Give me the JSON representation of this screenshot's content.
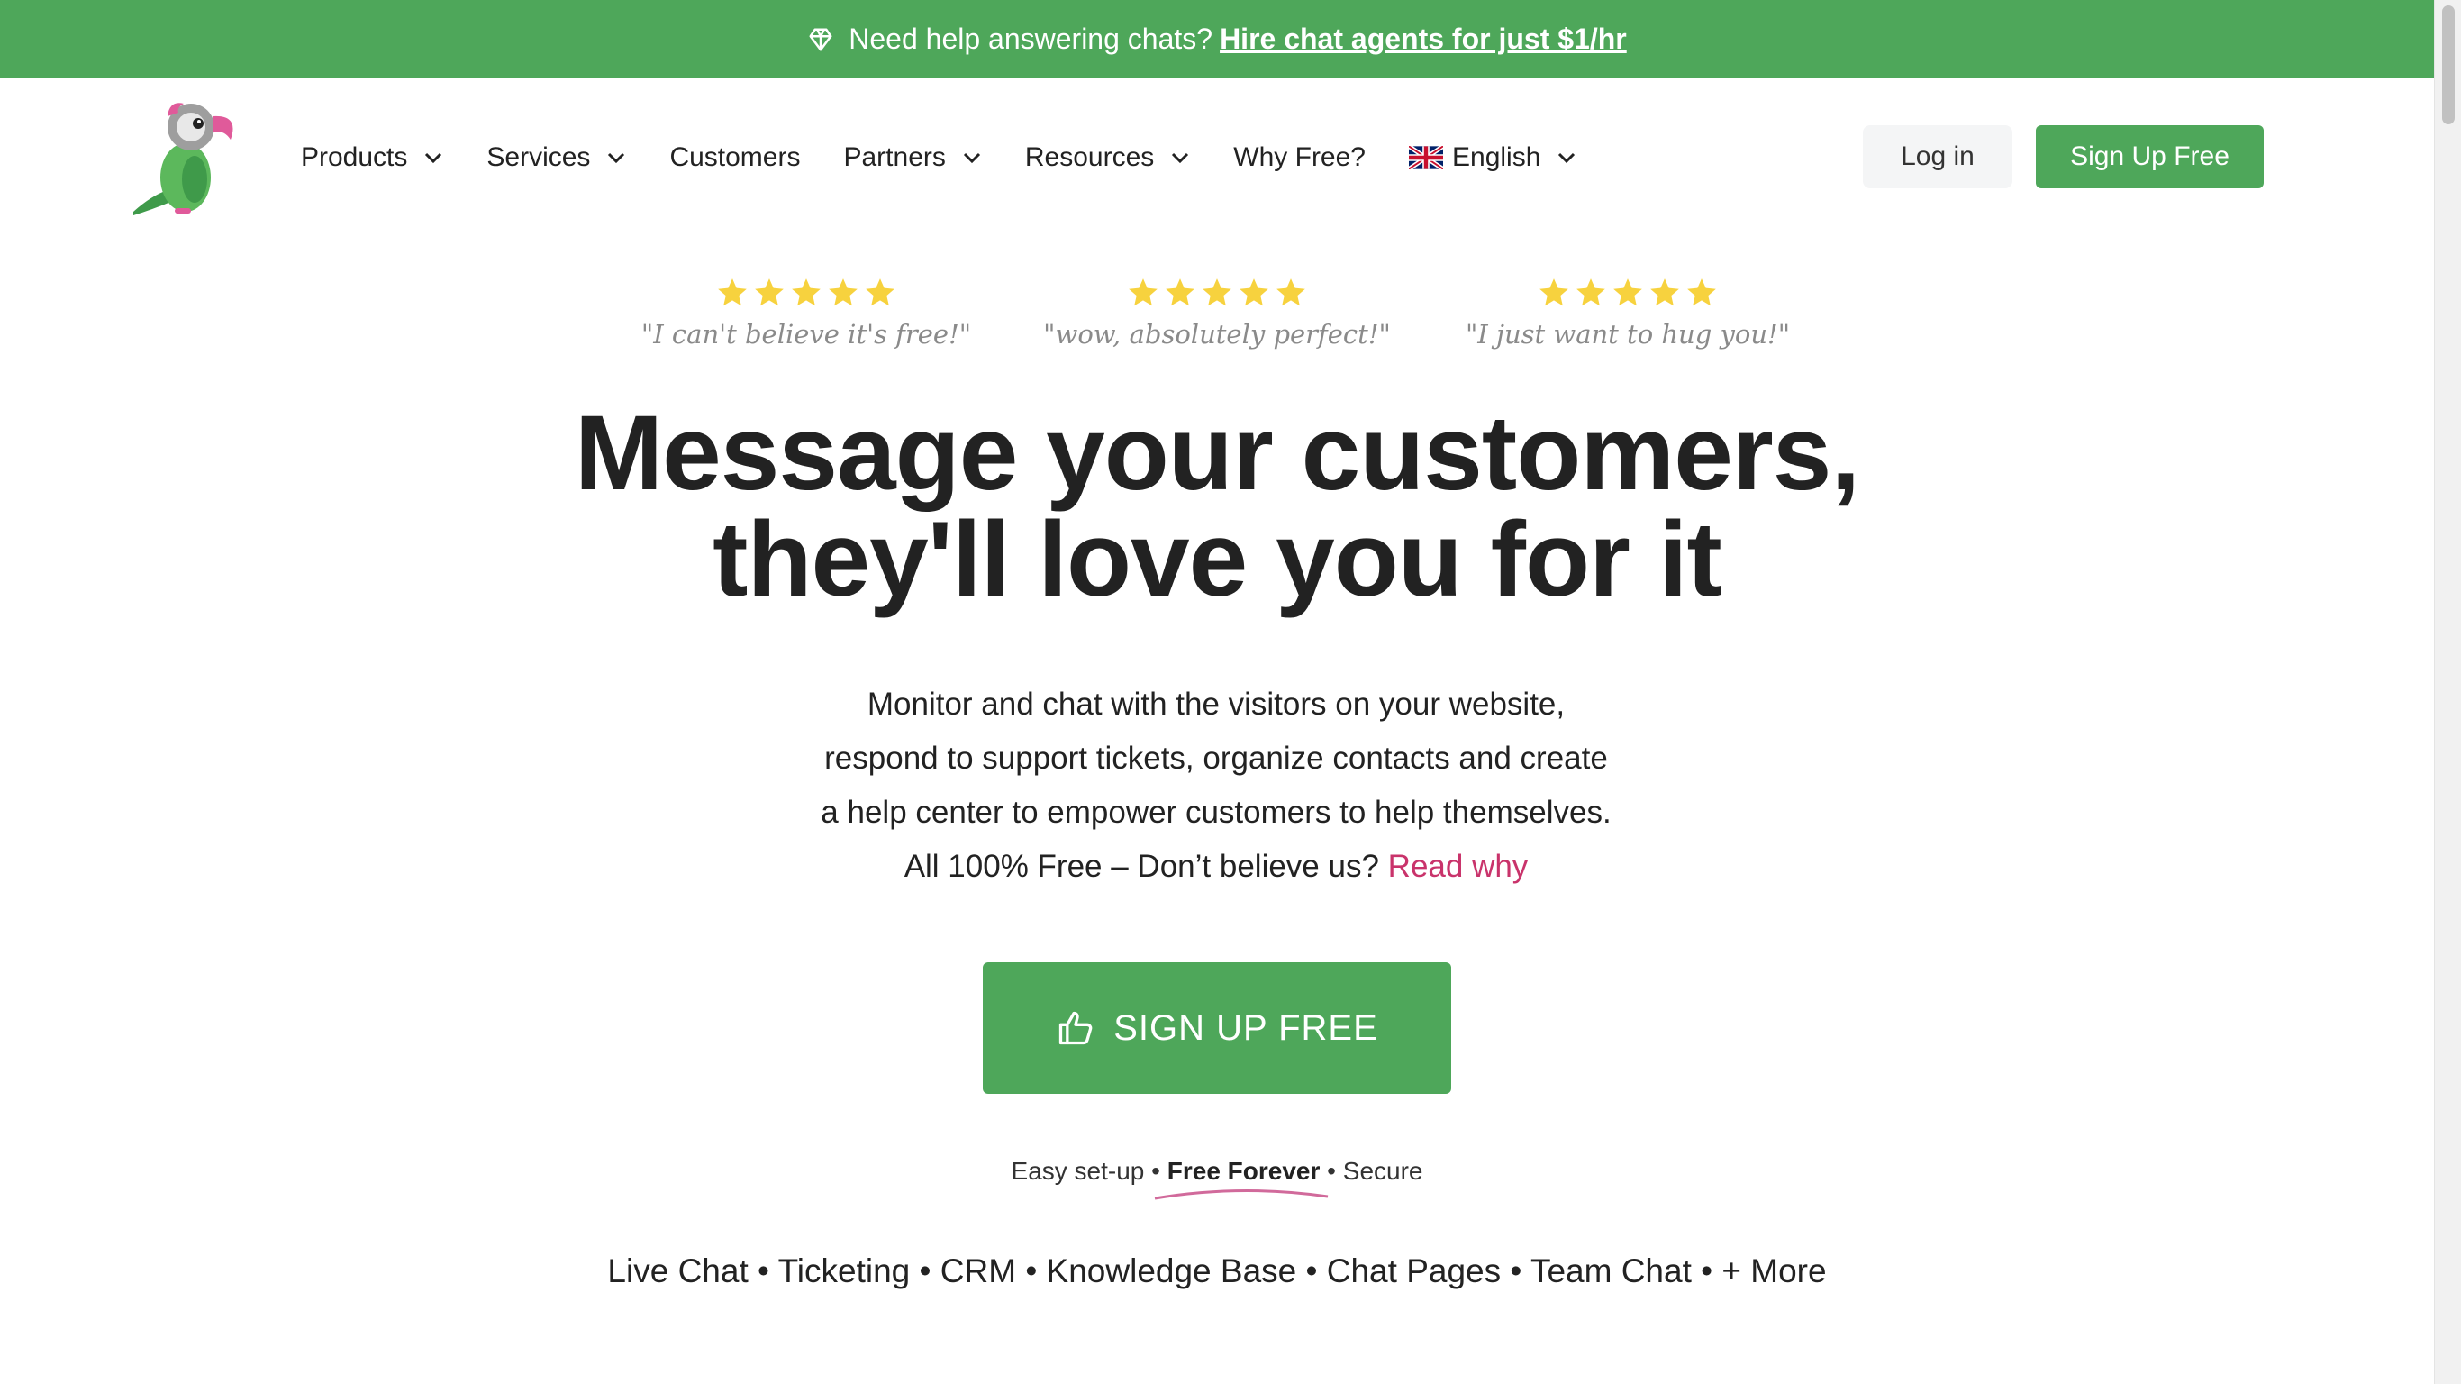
{
  "banner": {
    "icon": "diamond-icon",
    "text": "Need help answering chats?",
    "link": "Hire chat agents for just $1/hr",
    "bg_color": "#4ea75a"
  },
  "nav": {
    "logo": "parrot-logo",
    "items": [
      {
        "label": "Products",
        "dropdown": true
      },
      {
        "label": "Services",
        "dropdown": true
      },
      {
        "label": "Customers",
        "dropdown": false
      },
      {
        "label": "Partners",
        "dropdown": true
      },
      {
        "label": "Resources",
        "dropdown": true
      },
      {
        "label": "Why Free?",
        "dropdown": false
      }
    ],
    "language": {
      "label": "English",
      "flag": "uk-flag-icon"
    },
    "login_label": "Log in",
    "signup_label": "Sign Up Free"
  },
  "reviews": [
    {
      "stars": 5,
      "quote": "\"I can't believe it's free!\""
    },
    {
      "stars": 5,
      "quote": "\"wow, absolutely perfect!\""
    },
    {
      "stars": 5,
      "quote": "\"I just want to hug you!\""
    }
  ],
  "hero": {
    "title_line1": "Message your customers,",
    "title_line2": "they'll love you for it",
    "desc_line1": "Monitor and chat with the visitors on your website,",
    "desc_line2": "respond to support tickets, organize contacts and create",
    "desc_line3": "a help center to empower customers to help themselves.",
    "desc_line4": "All 100% Free – Don’t believe us?",
    "read_why": "Read why",
    "cta_label": "SIGN UP FREE",
    "cta_icon": "thumbs-up-icon"
  },
  "features": {
    "part1": "Easy set-up",
    "sep": "•",
    "part2": "Free Forever",
    "part3": "Secure"
  },
  "products_line": "Live Chat • Ticketing • CRM • Knowledge Base • Chat Pages • Team Chat • + More",
  "colors": {
    "brand_green": "#4ea75a",
    "star_yellow": "#f7d23e",
    "link_pink": "#c9336b"
  }
}
